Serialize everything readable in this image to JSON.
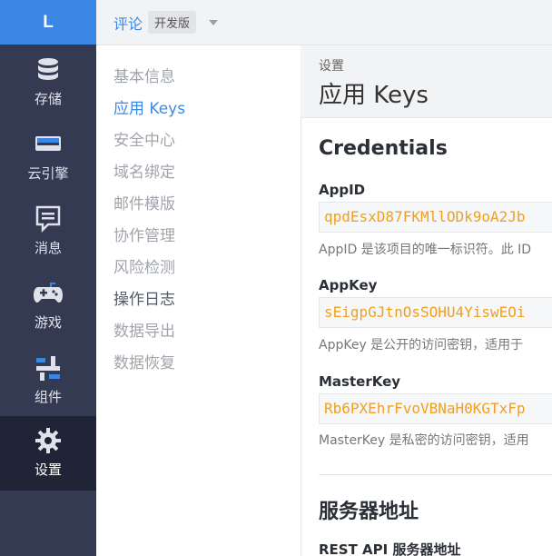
{
  "rail": {
    "logo": "L",
    "items": [
      {
        "label": "存储",
        "icon": "database-icon"
      },
      {
        "label": "云引擎",
        "icon": "server-icon"
      },
      {
        "label": "消息",
        "icon": "message-icon"
      },
      {
        "label": "游戏",
        "icon": "gamepad-icon"
      },
      {
        "label": "组件",
        "icon": "components-icon"
      },
      {
        "label": "设置",
        "icon": "gear-icon",
        "active": true
      }
    ]
  },
  "header": {
    "app_name": "评论",
    "env_badge": "开发版"
  },
  "subnav": {
    "items": [
      {
        "label": "基本信息"
      },
      {
        "label": "应用 Keys",
        "active": true
      },
      {
        "label": "安全中心"
      },
      {
        "label": "域名绑定"
      },
      {
        "label": "邮件模版"
      },
      {
        "label": "协作管理"
      },
      {
        "label": "风险检测"
      },
      {
        "label": "操作日志"
      },
      {
        "label": "数据导出"
      },
      {
        "label": "数据恢复"
      }
    ]
  },
  "page": {
    "breadcrumb": "设置",
    "title": "应用 Keys"
  },
  "credentials": {
    "title": "Credentials",
    "app_id": {
      "label": "AppID",
      "value": "qpdEsxD87FKMllODk9oA2Jb",
      "desc": "AppID 是该项目的唯一标识符。此 ID"
    },
    "app_key": {
      "label": "AppKey",
      "value": "sEigpGJtnOsSOHU4YiswEOi",
      "desc": "AppKey 是公开的访问密钥，适用于"
    },
    "master_key": {
      "label": "MasterKey",
      "value": "Rb6PXEhrFvoVBNaH0KGTxFp",
      "desc": "MasterKey 是私密的访问密钥，适用"
    }
  },
  "server": {
    "title": "服务器地址",
    "rest_api_label": "REST API 服务器地址"
  },
  "colors": {
    "accent": "#3b87e6",
    "sidebar": "#333a52",
    "sidebar_active": "#1f2537",
    "key_value": "#f0a020"
  }
}
